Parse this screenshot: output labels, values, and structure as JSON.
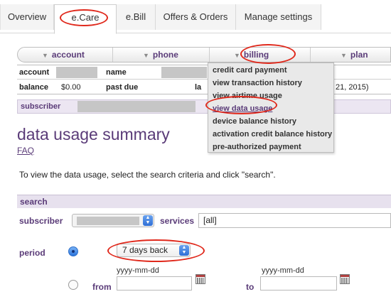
{
  "top_tabs": [
    {
      "label": "Overview"
    },
    {
      "label": "e.Care"
    },
    {
      "label": "e.Bill"
    },
    {
      "label": "Offers & Orders"
    },
    {
      "label": "Manage settings"
    }
  ],
  "sub_nav": {
    "items": [
      {
        "label": "account"
      },
      {
        "label": "phone"
      },
      {
        "label": "billing"
      },
      {
        "label": "plan"
      }
    ]
  },
  "account_info": {
    "account_label": "account",
    "name_label": "name",
    "balance_label": "balance",
    "balance_value": "$0.00",
    "past_due_label": "past due",
    "truncated_label": "la",
    "truncated_date": "21, 2015)"
  },
  "subscriber_strip": {
    "label": "subscriber"
  },
  "billing_menu": {
    "items": [
      {
        "label": "credit card payment"
      },
      {
        "label": "view transaction history"
      },
      {
        "label": "view airtime usage"
      },
      {
        "label": "view data usage"
      },
      {
        "label": "device balance history"
      },
      {
        "label": "activation credit balance history"
      },
      {
        "label": "pre-authorized payment"
      }
    ]
  },
  "page": {
    "title": "data usage summary",
    "faq": "FAQ",
    "instructions": "To view the data usage, select the search criteria and click \"search\"."
  },
  "search": {
    "header": "search",
    "subscriber_label": "subscriber",
    "services_label": "services",
    "services_value": "[all]",
    "period_label": "period",
    "period_selected": "7 days back",
    "date_format": "yyyy-mm-dd",
    "from_label": "from",
    "to_label": "to"
  },
  "colors": {
    "accent": "#5a3b78",
    "annotation": "#e0291c",
    "header_bg": "#e7e1ee"
  }
}
